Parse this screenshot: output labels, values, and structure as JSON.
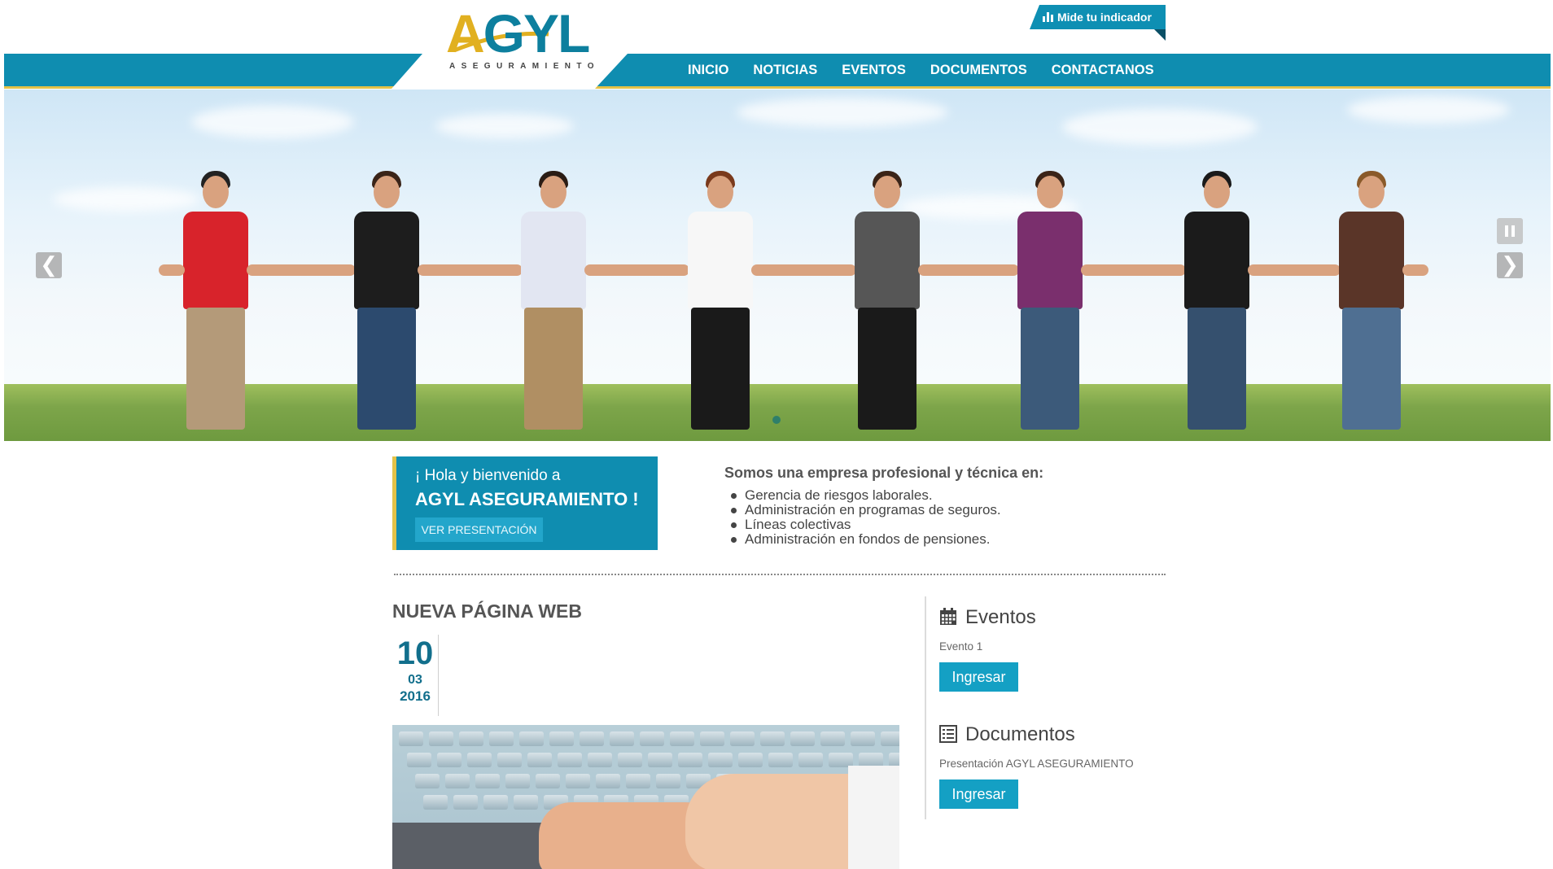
{
  "brand": {
    "logo_mark_a": "A",
    "logo_mark_rest": "GYL",
    "logo_tagline": "ASEGURAMIENTO",
    "colors": {
      "primary": "#0f8db0",
      "accent": "#e3c248",
      "dark_blue": "#126f8c"
    }
  },
  "header": {
    "indicator_button": {
      "icon": "bar-chart-icon",
      "label": "Mide tu indicador"
    },
    "nav": [
      "INICIO",
      "NOTICIAS",
      "EVENTOS",
      "DOCUMENTOS",
      "CONTACTANOS"
    ]
  },
  "slider": {
    "prev_icon": "chevron-left-icon",
    "next_icon": "chevron-right-icon",
    "prev_glyph": "❮",
    "next_glyph": "❯",
    "pause_icon": "pause-icon"
  },
  "welcome": {
    "line1": "¡ Hola y bienvenido a",
    "line2": "AGYL ASEGURAMIENTO !",
    "button": "VER PRESENTACIÓN"
  },
  "services": {
    "title": "Somos una empresa profesional y técnica en:",
    "items": [
      "Gerencia de riesgos laborales.",
      "Administración en programas de seguros.",
      "Líneas colectivas",
      "Administración en fondos de pensiones."
    ]
  },
  "news": {
    "title": "NUEVA PÁGINA WEB",
    "day": "10",
    "month": "03",
    "year": "2016"
  },
  "sidebar": {
    "events": {
      "icon": "calendar-icon",
      "title": "Eventos",
      "item": "Evento 1",
      "button": "Ingresar"
    },
    "documents": {
      "icon": "list-icon",
      "title": "Documentos",
      "item": "Presentación AGYL ASEGURAMIENTO",
      "button": "Ingresar"
    }
  }
}
